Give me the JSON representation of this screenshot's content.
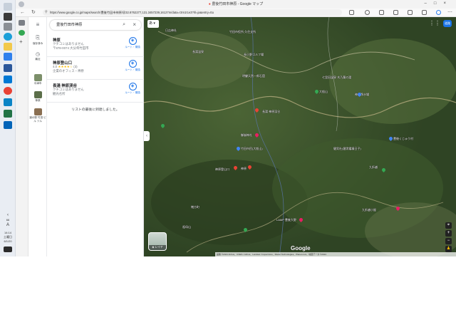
{
  "window": {
    "title": "豊後竹田市神原 - Google マップ"
  },
  "browser": {
    "address": "https://www.google.co.jp/maps/search/豊後竹田市神原/@32.8762277,131.3457239,16127m/data=!3m1!1e3?hl=ja&entry=ttu"
  },
  "taskbar": {
    "chevron": "‹",
    "count": "66",
    "ime": "A",
    "time": "14:14",
    "weekday": "土曜日",
    "date": "6/1/20"
  },
  "rail": {
    "items": [
      {
        "label": "保存済み"
      },
      {
        "label": "最近"
      },
      {
        "label": "中津市"
      },
      {
        "label": "神原"
      },
      {
        "label": "道の駅 竹田 ビル ツル"
      }
    ]
  },
  "search": {
    "query": "豊後竹田市神原"
  },
  "results": [
    {
      "name": "神原",
      "line2": "クチコミはありません",
      "line3": "〒878-0074 大分県竹田市",
      "route": "ルート・乗換"
    },
    {
      "name": "神原登山口",
      "rating": "4.0",
      "stars": "★★★★☆",
      "count": "(3)",
      "line3": "企業のオフィス・神原",
      "route": "ルート・乗換"
    },
    {
      "name": "長湯 神原渓谷",
      "line2": "クチコミはありません",
      "line3": "観光名所",
      "route": "ルート・乗換"
    }
  ],
  "end_text": "リストの最後に到達しました。",
  "map": {
    "lang_button": "あ",
    "avatar": "道路",
    "layer_label": "レイヤ",
    "google": "Google",
    "attribution": "画像 ©2024 Airbus、CNES / Airbus、Landsat / Copernicus、Maxar Technologies、Planet.com、地図データ ©2024",
    "labels": [
      {
        "text": "竹田市役所 久住支所"
      },
      {
        "text": "日吉神社"
      },
      {
        "text": "長小野ゴルフ場"
      },
      {
        "text": "長湯温泉"
      },
      {
        "text": "明礬天然一郎石窟"
      },
      {
        "text": "七里田温泉 木乃葉の湯"
      },
      {
        "text": "大船山"
      },
      {
        "text": "神原浄水場"
      },
      {
        "text": "長湯 神原渓谷"
      },
      {
        "text": "御嶽神社"
      },
      {
        "text": "竹田市民(大船山)"
      },
      {
        "text": "神原登山口"
      },
      {
        "text": "神原"
      },
      {
        "text": "九折越小屋"
      },
      {
        "text": "豊後くじゅう村"
      },
      {
        "text": "LAMP 豊後大野"
      },
      {
        "text": "緒方町"
      },
      {
        "text": "祖母山"
      },
      {
        "text": "健男社(健男霜凝日子)"
      },
      {
        "text": "九折越"
      }
    ]
  },
  "colors": {
    "accent": "#1a73e8",
    "pin_red": "#ea4335",
    "pin_green": "#34a853",
    "pin_pink": "#e91e63",
    "pin_blue": "#4285f4",
    "map_base": "#39502a"
  }
}
